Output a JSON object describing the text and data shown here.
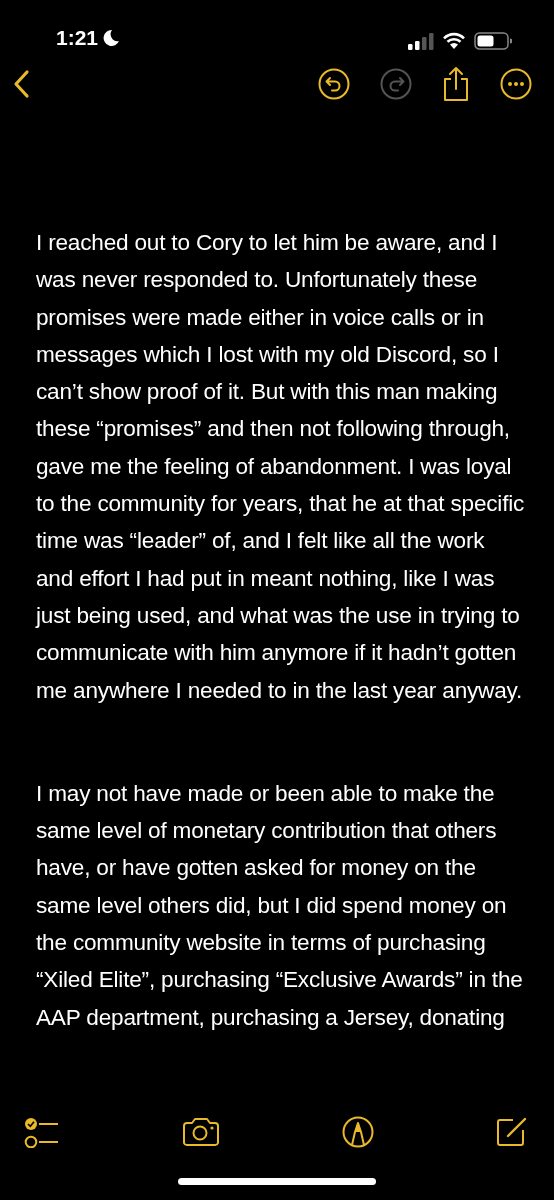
{
  "status_bar": {
    "time": "1:21",
    "focus_moon": true
  },
  "nav_bar": {
    "buttons": [
      {
        "kind": "back",
        "disabled": false
      },
      {
        "kind": "undo",
        "disabled": false
      },
      {
        "kind": "redo",
        "disabled": true
      },
      {
        "kind": "share",
        "disabled": false
      },
      {
        "kind": "more",
        "disabled": false
      }
    ]
  },
  "note": {
    "paragraphs": [
      "I reached out to Cory to let him be aware, and I was never responded to. Unfortunately these promises were made either in voice calls or in messages which I lost with my old Discord, so I can’t show proof of it. But with this man making these “promises” and then not following through, gave me the feeling of abandonment. I was loyal to the community for years, that he at that specific time was “leader” of, and I felt like all the work and effort I had put in meant nothing, like I was just being used, and what was the use in trying to communicate with him anymore if it hadn’t gotten me anywhere I needed to in the last year anyway.",
      "I may not have made or been able to make the same level of monetary contribution that others have, or have gotten asked for money on the same level others did, but I did spend money on the community website in terms of purchasing “Xiled Elite”, purchasing “Exclusive Awards” in the AAP department, purchasing a Jersey, donating"
    ]
  },
  "bottom_toolbar": {
    "buttons": [
      {
        "kind": "checklist"
      },
      {
        "kind": "camera"
      },
      {
        "kind": "markup"
      },
      {
        "kind": "compose"
      }
    ]
  }
}
